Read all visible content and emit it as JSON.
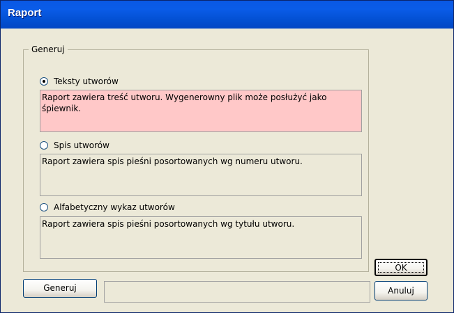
{
  "window": {
    "title": "Raport"
  },
  "group": {
    "legend": "Generuj",
    "options": [
      {
        "label": "Teksty utworów",
        "checked": true,
        "description": "Raport zawiera treść utworu. Wygenerowny plik może posłużyć jako śpiewnik."
      },
      {
        "label": "Spis utworów",
        "checked": false,
        "description": "Raport zawiera spis pieśni posortowanych wg numeru utworu."
      },
      {
        "label": "Alfabetyczny wykaz utworów",
        "checked": false,
        "description": "Raport zawiera spis pieśni posortowanych wg tytułu utworu."
      }
    ]
  },
  "buttons": {
    "generate": "Generuj",
    "ok": "OK",
    "cancel": "Anuluj"
  },
  "colors": {
    "selected_description": "#FFC8C8",
    "titlebar": "#0A58E4",
    "dialog_background": "#ECE9D8"
  }
}
